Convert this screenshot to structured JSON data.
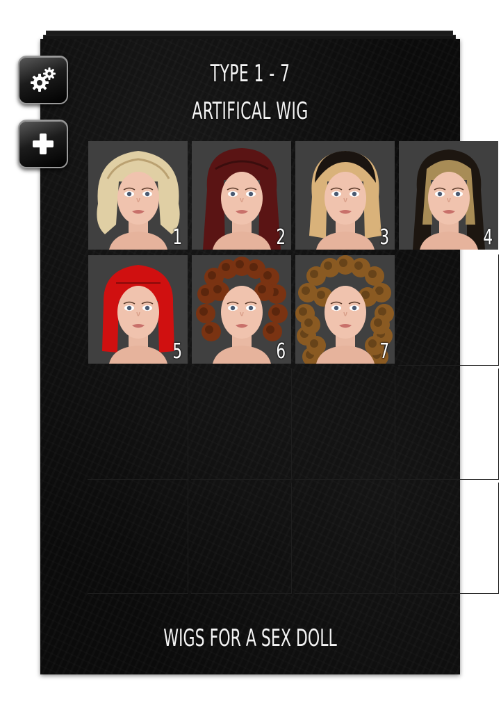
{
  "header": {
    "line1": "TYPE 1 - 7",
    "line2": "ARTIFICAL WIG"
  },
  "footer": {
    "text": "WIGS FOR A SEX DOLL"
  },
  "controls": {
    "settings_icon": "gears-icon",
    "add_icon": "plus-icon"
  },
  "wigs": [
    {
      "number": "1",
      "hair_color": "#e0cfa4",
      "hair_style": "feathered-blonde"
    },
    {
      "number": "2",
      "hair_color": "#5a1414",
      "hair_style": "long-auburn"
    },
    {
      "number": "3",
      "hair_color": "#d9b27a",
      "hair_style": "ombre-bob"
    },
    {
      "number": "4",
      "hair_color": "#a88c56",
      "hair_style": "long-highlight"
    },
    {
      "number": "5",
      "hair_color": "#d01010",
      "hair_style": "red-bob-bangs"
    },
    {
      "number": "6",
      "hair_color": "#7a3312",
      "hair_style": "short-curly"
    },
    {
      "number": "7",
      "hair_color": "#8a5a22",
      "hair_style": "long-curly"
    }
  ]
}
